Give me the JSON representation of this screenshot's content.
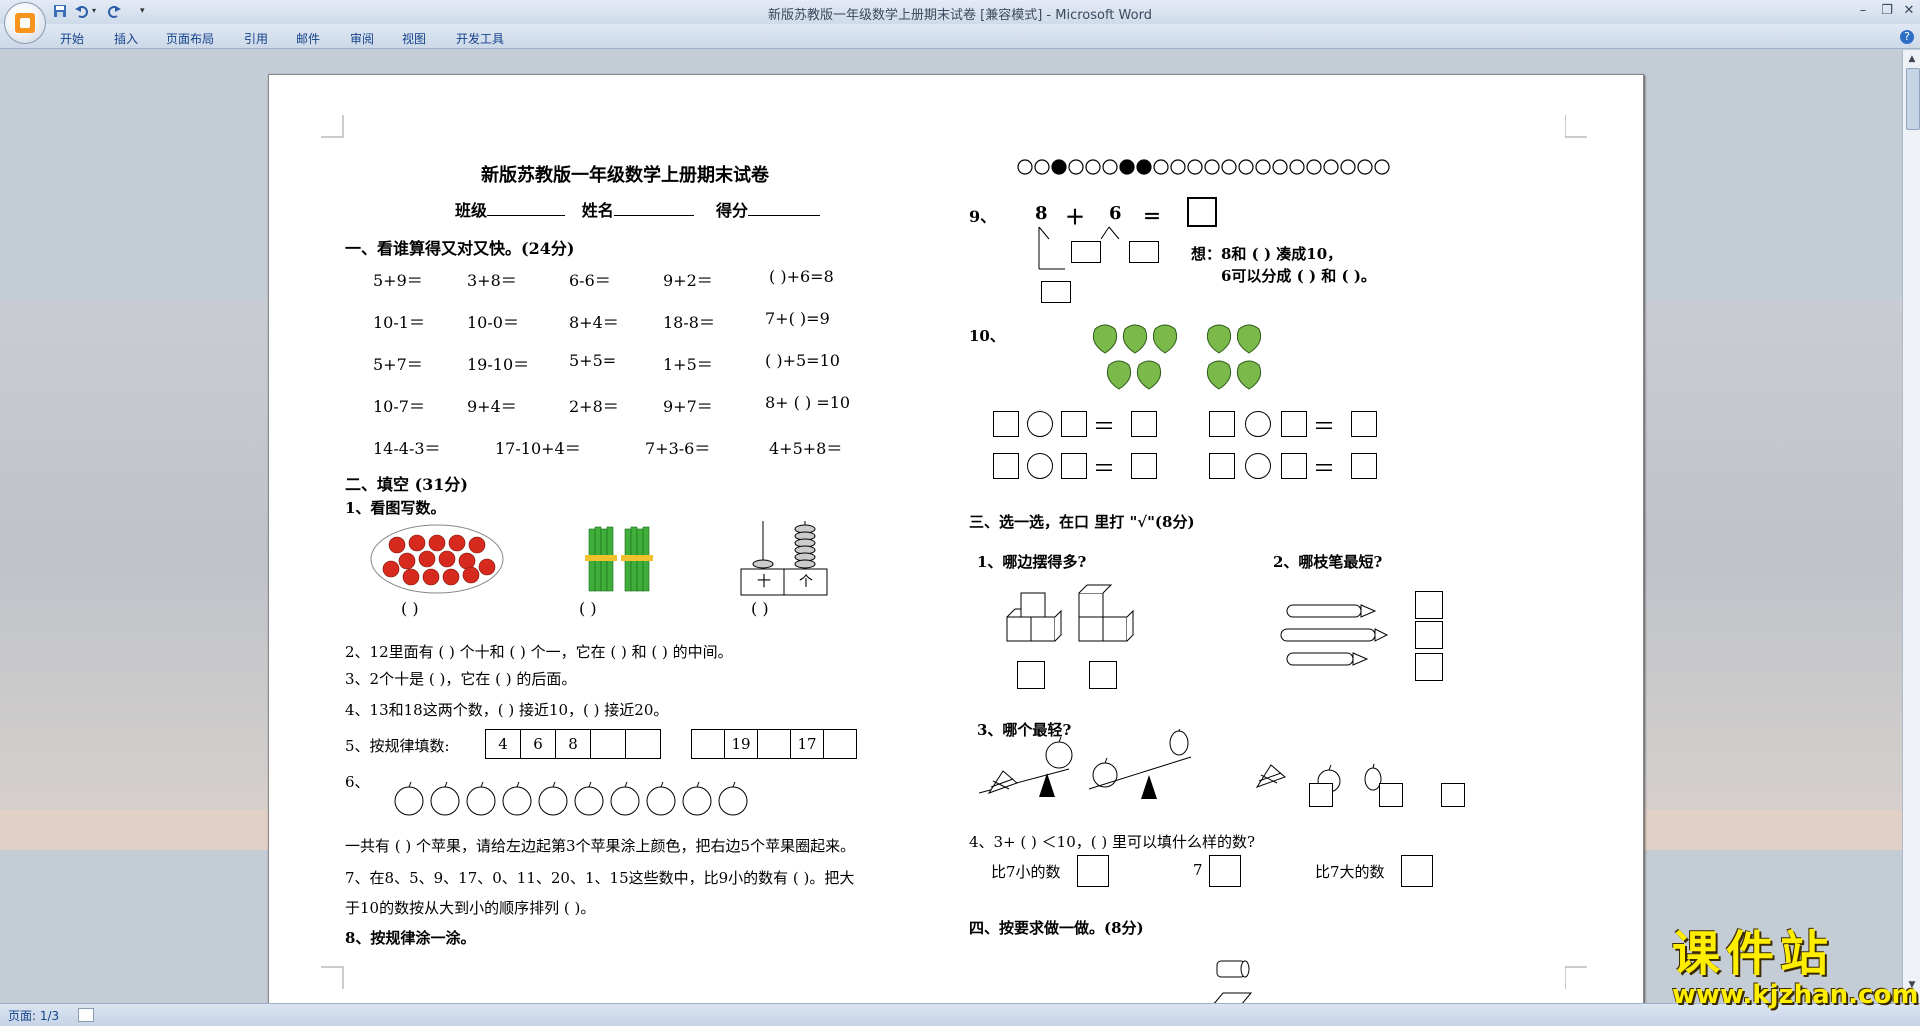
{
  "window": {
    "title": "新版苏教版一年级数学上册期末试卷 [兼容模式] - Microsoft Word"
  },
  "ribbon": {
    "tabs": [
      "开始",
      "插入",
      "页面布局",
      "引用",
      "邮件",
      "审阅",
      "视图",
      "开发工具"
    ]
  },
  "status": {
    "page": "页面: 1/3"
  },
  "watermark": {
    "top": "课件站",
    "bottom": "www.kjzhan.com"
  },
  "doc": {
    "title": "新版苏教版一年级数学上册期末试卷",
    "info": {
      "class": "班级",
      "name": "姓名",
      "score": "得分"
    },
    "s1": {
      "heading": "一、看谁算得又对又快。(24分)",
      "rows": [
        [
          "5+9＝",
          "3+8＝",
          "6-6＝",
          "9+2＝",
          "(    )+6=8"
        ],
        [
          "10-1＝",
          "10-0＝",
          "8+4＝",
          "18-8＝",
          "7+(    )=9"
        ],
        [
          "5+7＝",
          "19-10＝",
          "5+5=",
          "1+5＝",
          "(    )+5=10"
        ],
        [
          "10-7＝",
          "9+4＝",
          "2+8＝",
          "9+7＝",
          "8+ (    ) =10"
        ],
        [
          "14-4-3＝",
          "17-10+4＝",
          "7+3-6＝",
          "4+5+8＝"
        ]
      ]
    },
    "s2": {
      "heading": "二、填空 (31分)",
      "q1": "1、看图写数。",
      "q1_answers": [
        "(        )",
        "(        )",
        "(        )"
      ],
      "abacus_labels": [
        "十",
        "个"
      ],
      "q2": "2、12里面有 (     ) 个十和 (     ) 个一，它在 (      ) 和 (      ) 的中间。",
      "q3": "3、2个十是 (     )，它在 (     ) 的后面。",
      "q4": "4、13和18这两个数，(      ) 接近10，(      ) 接近20。",
      "q5": "5、按规律填数:",
      "q5_seq1": [
        "4",
        "6",
        "8",
        "",
        ""
      ],
      "q5_seq2": [
        "",
        "19",
        "",
        "17",
        ""
      ],
      "q6": "6、",
      "q6_text": "一共有 (          ) 个苹果，请给左边起第3个苹果涂上颜色，把右边5个苹果圈起来。",
      "q7a": "7、在8、5、9、17、0、11、20、1、15这些数中，比9小的数有 (              )。把大",
      "q7b": "于10的数按从大到小的顺序排列 (                                                 )。",
      "q8": "8、按规律涂一涂。"
    },
    "right": {
      "dots": [
        "o",
        "o",
        "f",
        "o",
        "o",
        "o",
        "f",
        "f",
        "o",
        "o",
        "o",
        "o",
        "o",
        "o",
        "o",
        "o",
        "o",
        "o",
        "o",
        "o",
        "o",
        "o"
      ],
      "q9_label": "9、",
      "q9_expr": [
        "8",
        "＋",
        "6",
        "＝"
      ],
      "q9_think1": "想：8和 (      ) 凑成10，",
      "q9_think2": "6可以分成 (     ) 和 (      )。",
      "q10_label": "10、",
      "s3_heading": "三、选一选，在口 里打 \"√\"(8分)",
      "s3_q1": "1、哪边摆得多?",
      "s3_q2": "2、哪枝笔最短?",
      "s3_q3": "3、哪个最轻?",
      "s3_q4": "4、3+ (    ) ＜10，(    ) 里可以填什么样的数?",
      "s3_q4_less": "比7小的数",
      "s3_q4_seven": "7",
      "s3_q4_more": "比7大的数",
      "s4_heading": "四、按要求做一做。(8分)"
    }
  }
}
